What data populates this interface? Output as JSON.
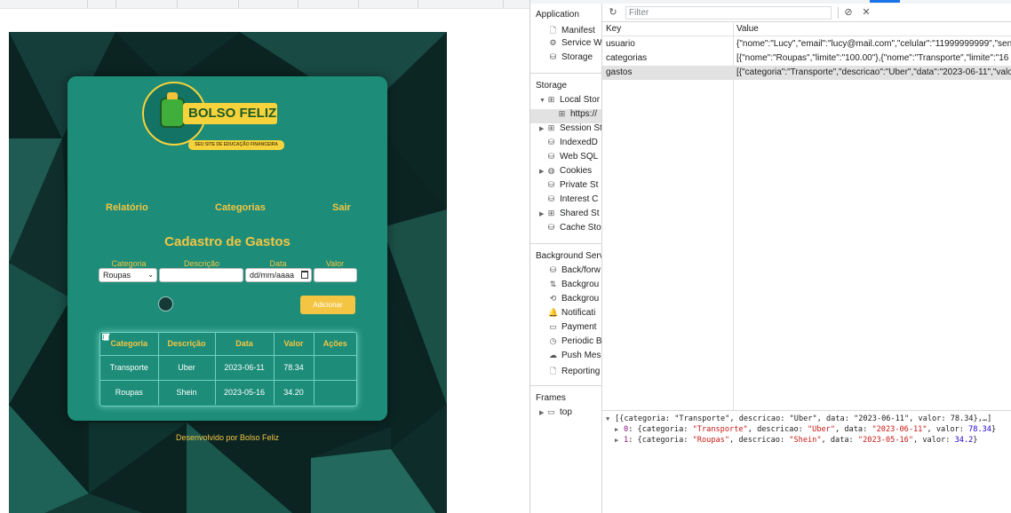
{
  "site": {
    "logo_text": "BOLSO FELIZ",
    "logo_tagline": "SEU SITE DE EDUCAÇÃO FINANCEIRA",
    "nav": [
      "Relatório",
      "Categorias",
      "Sair"
    ],
    "form_title": "Cadastro de Gastos",
    "labels": {
      "categoria": "Categoria",
      "descricao": "Descrição",
      "data": "Data",
      "valor": "Valor"
    },
    "categoria_selected": "Roupas",
    "data_placeholder": "dd/mm/aaaa",
    "add_button": "Adicionar",
    "table": {
      "headers": [
        "Categoria",
        "Descrição",
        "Data",
        "Valor",
        "Ações"
      ],
      "rows": [
        [
          "Transporte",
          "Uber",
          "2023-06-11",
          "78.34"
        ],
        [
          "Roupas",
          "Shein",
          "2023-05-16",
          "34.20"
        ]
      ]
    },
    "footer": "Desenvolvido por Bolso Feliz",
    "colors": {
      "card": "#1d8d79",
      "accent": "#f4c542"
    }
  },
  "devtools": {
    "sidebar": {
      "application_header": "Application",
      "application_items": [
        "Manifest",
        "Service W",
        "Storage"
      ],
      "storage_header": "Storage",
      "storage_items": [
        "Local Stor",
        "https://",
        "Session St",
        "IndexedD",
        "Web SQL",
        "Cookies",
        "Private St",
        "Interest C",
        "Shared St",
        "Cache Sto"
      ],
      "background_header": "Background Serv",
      "background_items": [
        "Back/forw",
        "Backgrou",
        "Backgrou",
        "Notificati",
        "Payment",
        "Periodic B",
        "Push Mes",
        "Reporting"
      ],
      "frames_header": "Frames",
      "frames_items": [
        "top"
      ]
    },
    "filter_placeholder": "Filter",
    "columns": {
      "key": "Key",
      "value": "Value"
    },
    "entries": [
      {
        "key": "usuario",
        "value": "{\"nome\":\"Lucy\",\"email\":\"lucy@mail.com\",\"celular\":\"11999999999\",\"senha\":"
      },
      {
        "key": "categorias",
        "value": "[{\"nome\":\"Roupas\",\"limite\":\"100.00\"},{\"nome\":\"Transporte\",\"limite\":\"16"
      },
      {
        "key": "gastos",
        "value": "[{\"categoria\":\"Transporte\",\"descricao\":\"Uber\",\"data\":\"2023-06-11\",\"valor"
      }
    ],
    "preview": {
      "root": "[{categoria: \"Transporte\", descricao: \"Uber\", data: \"2023-06-11\", valor: 78.34},…]",
      "items": [
        {
          "index": "0",
          "categoria": "\"Transporte\"",
          "descricao": "\"Uber\"",
          "data": "\"2023-06-11\"",
          "valor": "78.34"
        },
        {
          "index": "1",
          "categoria": "\"Roupas\"",
          "descricao": "\"Shein\"",
          "data": "\"2023-05-16\"",
          "valor": "34.2"
        }
      ]
    }
  }
}
